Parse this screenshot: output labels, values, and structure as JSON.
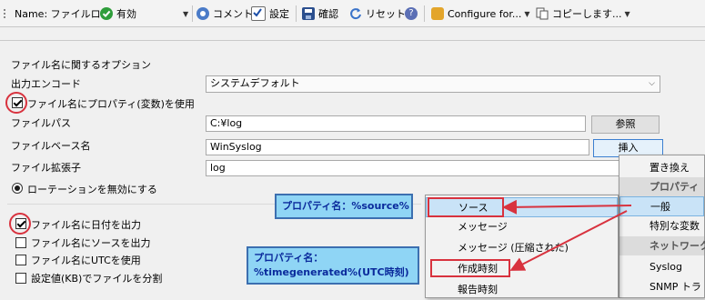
{
  "toolbar": {
    "name_label": "Name: ファイルログ",
    "status_label": "有効",
    "comment_label": "コメント",
    "settings_label": "設定",
    "confirm_label": "確認",
    "reset_label": "リセット",
    "configure_label": "Configure for...",
    "copy_label": "コピーします..."
  },
  "form": {
    "section_title": "ファイル名に関するオプション",
    "encode_label": "出力エンコード",
    "encode_value": "システムデフォルト",
    "use_property_label": "ファイル名にプロパティ(変数)を使用",
    "path_label": "ファイルパス",
    "path_value": "C:¥log",
    "browse_button": "参照",
    "base_label": "ファイルベース名",
    "base_value": "WinSyslog",
    "insert_button": "挿入",
    "ext_label": "ファイル拡張子",
    "ext_value": "log",
    "rotation_label": "ローテーションを無効にする",
    "date_label": "ファイル名に日付を出力",
    "source_label": "ファイル名にソースを出力",
    "utc_label": "ファイル名にUTCを使用",
    "split_label": "設定値(KB)でファイルを分割"
  },
  "menu_right": {
    "replace": "置き換え",
    "property_group": "プロパティ",
    "general": "一般",
    "special": "特別な変数",
    "network_group": "ネットワーク",
    "syslog": "Syslog",
    "snmp": "SNMP トラ"
  },
  "menu_sub": {
    "source": "ソース",
    "message": "メッセージ",
    "message_compressed": "メッセージ (圧縮された)",
    "created_time": "作成時刻",
    "report_time": "報告時刻"
  },
  "callouts": {
    "source_line": "プロパティ名：%source%",
    "utc_line1": "プロパティ名：",
    "utc_line2": "%timegenerated%(UTC時刻)"
  },
  "colors": {
    "highlight": "#c9e3f7",
    "annotation_red": "#d8323e",
    "callout_bg": "#8fd5f5",
    "callout_text": "#0a2a9c"
  }
}
